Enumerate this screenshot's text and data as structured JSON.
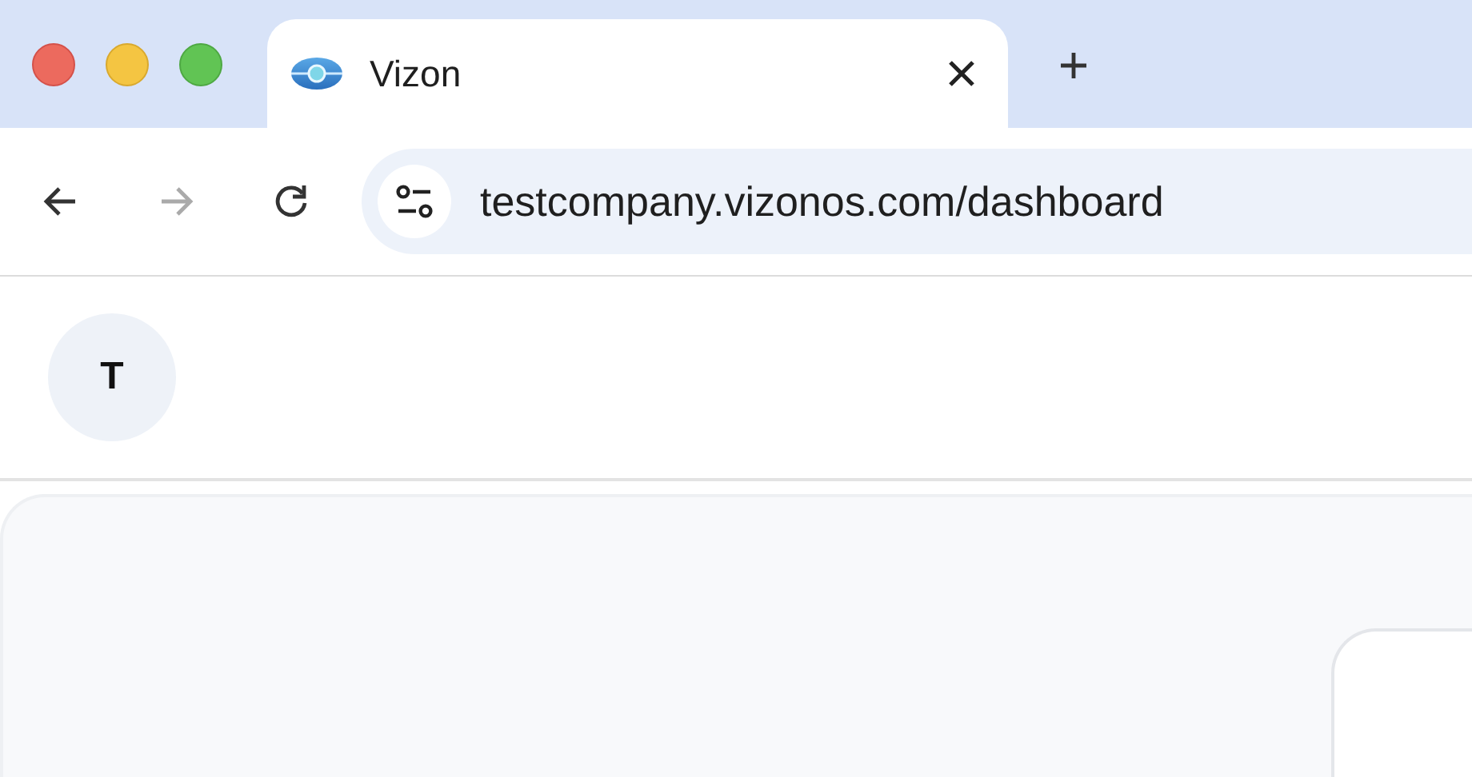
{
  "tabs": [
    {
      "title": "Vizon",
      "selected": true
    }
  ],
  "navigation": {
    "back_disabled": false,
    "forward_disabled": true
  },
  "address_bar": {
    "url": "testcompany.vizonos.com/dashboard"
  },
  "header": {
    "avatar_initial": "T"
  }
}
